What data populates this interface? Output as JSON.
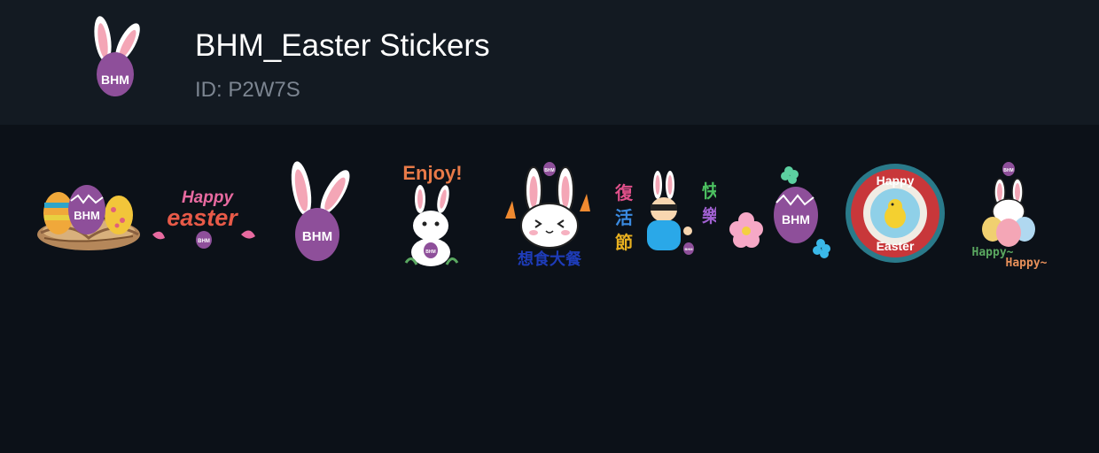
{
  "header": {
    "title": "BHM_Easter Stickers",
    "id_label": "ID: P2W7S",
    "icon": "bunny-ears-bhm-egg-icon",
    "icon_text": "BHM"
  },
  "colors": {
    "background": "#0c1118",
    "header_bg": "#131a22",
    "title": "#ffffff",
    "subtitle": "#7c8591",
    "brand_purple": "#8e4f9a",
    "ear_pink": "#f4a6b6"
  },
  "stickers": [
    {
      "name": "eggs-in-nest-sticker",
      "text": "BHM"
    },
    {
      "name": "happy-easter-lettering-sticker",
      "line1": "Happy",
      "line2": "easter",
      "badge": "BHM"
    },
    {
      "name": "bunny-ears-bhm-egg-sticker",
      "text": "BHM"
    },
    {
      "name": "enjoy-bunny-sticker",
      "text": "Enjoy!",
      "badge": "BHM"
    },
    {
      "name": "hungry-bunny-sticker",
      "text": "想食大餐",
      "badge": "BHM"
    },
    {
      "name": "happy-easter-chinese-sticker",
      "left_text": [
        "復",
        "活",
        "節"
      ],
      "right_text": [
        "快",
        "樂"
      ],
      "badge": "BHM"
    },
    {
      "name": "flower-egg-sticker",
      "text": "BHM"
    },
    {
      "name": "happy-easter-wreath-sticker",
      "top": "Happy",
      "bottom": "Easter"
    },
    {
      "name": "happy-happy-bunny-sticker",
      "line1": "Happy~",
      "line2": "Happy~",
      "badge": "BHM"
    }
  ]
}
